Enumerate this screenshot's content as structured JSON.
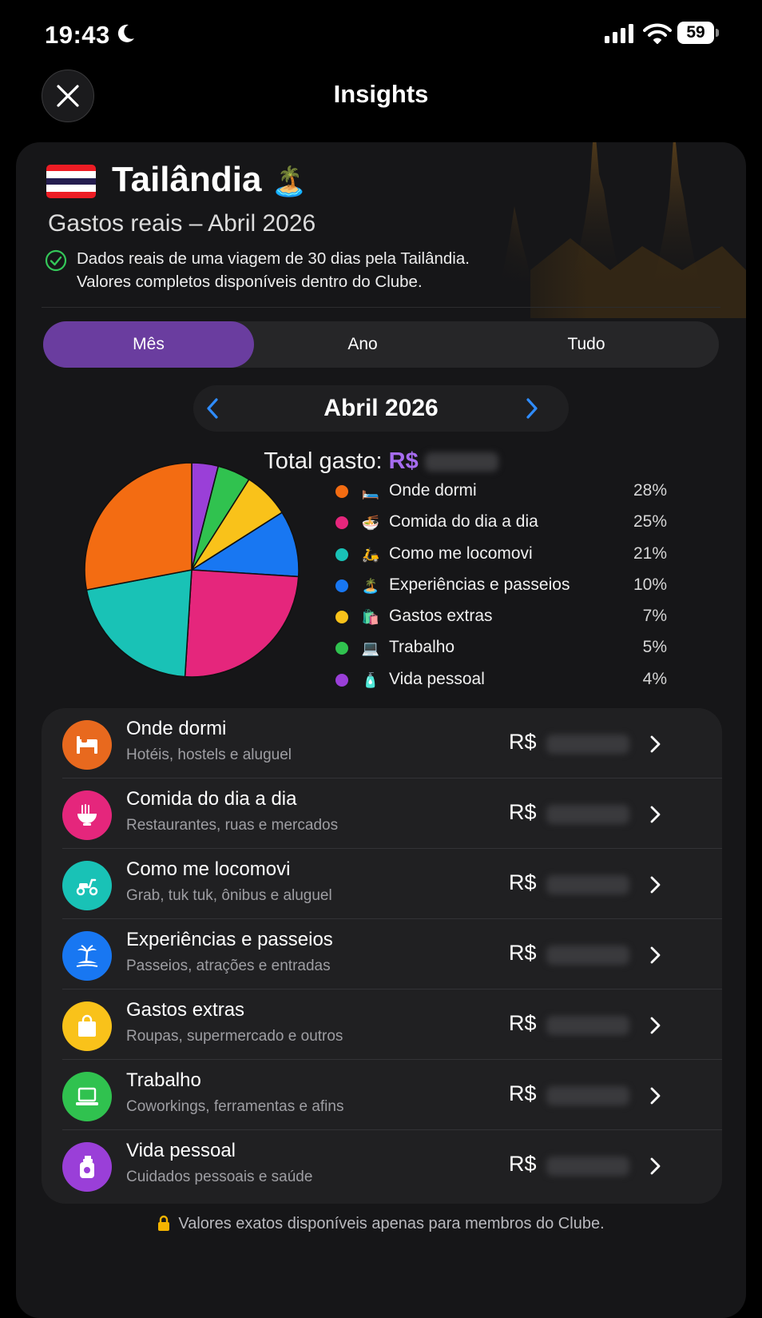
{
  "status_bar": {
    "time": "19:43",
    "battery": "59"
  },
  "nav": {
    "title": "Insights"
  },
  "header": {
    "country": "Tailândia",
    "country_emoji": "🏝️",
    "subtitle": "Gastos reais – Abril 2026",
    "note_line1": "Dados reais de uma viagem de 30 dias pela Tailândia.",
    "note_line2": "Valores completos disponíveis dentro do Clube."
  },
  "tabs": [
    {
      "label": "Mês",
      "active": true
    },
    {
      "label": "Ano",
      "active": false
    },
    {
      "label": "Tudo",
      "active": false
    }
  ],
  "period": {
    "label": "Abril 2026"
  },
  "total": {
    "label": "Total gasto:",
    "currency": "R$"
  },
  "chart_data": {
    "type": "pie",
    "categories": [
      "Onde dormi",
      "Comida do dia a dia",
      "Como me locomovi",
      "Experiências e passeios",
      "Gastos extras",
      "Trabalho",
      "Vida pessoal"
    ],
    "values": [
      28,
      25,
      21,
      10,
      7,
      5,
      4
    ],
    "colors": [
      "#f36c12",
      "#e5267c",
      "#19c2b6",
      "#1877f2",
      "#f9c21a",
      "#30c24f",
      "#9a3fd8"
    ]
  },
  "legend": [
    {
      "icon": "bed-icon",
      "emoji": "🛏️",
      "label": "Onde dormi",
      "pct": "28%",
      "color": "#f36c12"
    },
    {
      "icon": "noodle-bowl-icon",
      "emoji": "🍜",
      "label": "Comida do dia a dia",
      "pct": "25%",
      "color": "#e5267c"
    },
    {
      "icon": "scooter-icon",
      "emoji": "🛵",
      "label": "Como me locomovi",
      "pct": "21%",
      "color": "#19c2b6"
    },
    {
      "icon": "island-icon",
      "emoji": "🏝️",
      "label": "Experiências e passeios",
      "pct": "10%",
      "color": "#1877f2"
    },
    {
      "icon": "shopping-bag-icon",
      "emoji": "🛍️",
      "label": "Gastos extras",
      "pct": "7%",
      "color": "#f9c21a"
    },
    {
      "icon": "laptop-icon",
      "emoji": "💻",
      "label": "Trabalho",
      "pct": "5%",
      "color": "#30c24f"
    },
    {
      "icon": "lotion-bottle-icon",
      "emoji": "🧴",
      "label": "Vida pessoal",
      "pct": "4%",
      "color": "#9a3fd8"
    }
  ],
  "categories": [
    {
      "icon": "bed-icon",
      "title": "Onde dormi",
      "subtitle": "Hotéis, hostels e aluguel",
      "currency": "R$",
      "color": "#e8691e"
    },
    {
      "icon": "noodle-bowl-icon",
      "title": "Comida do dia a dia",
      "subtitle": "Restaurantes, ruas e mercados",
      "currency": "R$",
      "color": "#e5267c"
    },
    {
      "icon": "scooter-icon",
      "title": "Como me locomovi",
      "subtitle": "Grab, tuk tuk, ônibus e aluguel",
      "currency": "R$",
      "color": "#19c2b6"
    },
    {
      "icon": "island-icon",
      "title": "Experiências e passeios",
      "subtitle": "Passeios, atrações e entradas",
      "currency": "R$",
      "color": "#1877f2"
    },
    {
      "icon": "shopping-bag-icon",
      "title": "Gastos extras",
      "subtitle": "Roupas, supermercado e outros",
      "currency": "R$",
      "color": "#f9c21a"
    },
    {
      "icon": "laptop-icon",
      "title": "Trabalho",
      "subtitle": "Coworkings, ferramentas e afins",
      "currency": "R$",
      "color": "#30c24f"
    },
    {
      "icon": "lotion-bottle-icon",
      "title": "Vida pessoal",
      "subtitle": "Cuidados pessoais e saúde",
      "currency": "R$",
      "color": "#9a3fd8"
    }
  ],
  "footer": {
    "text": "Valores exatos disponíveis apenas para membros do Clube."
  }
}
